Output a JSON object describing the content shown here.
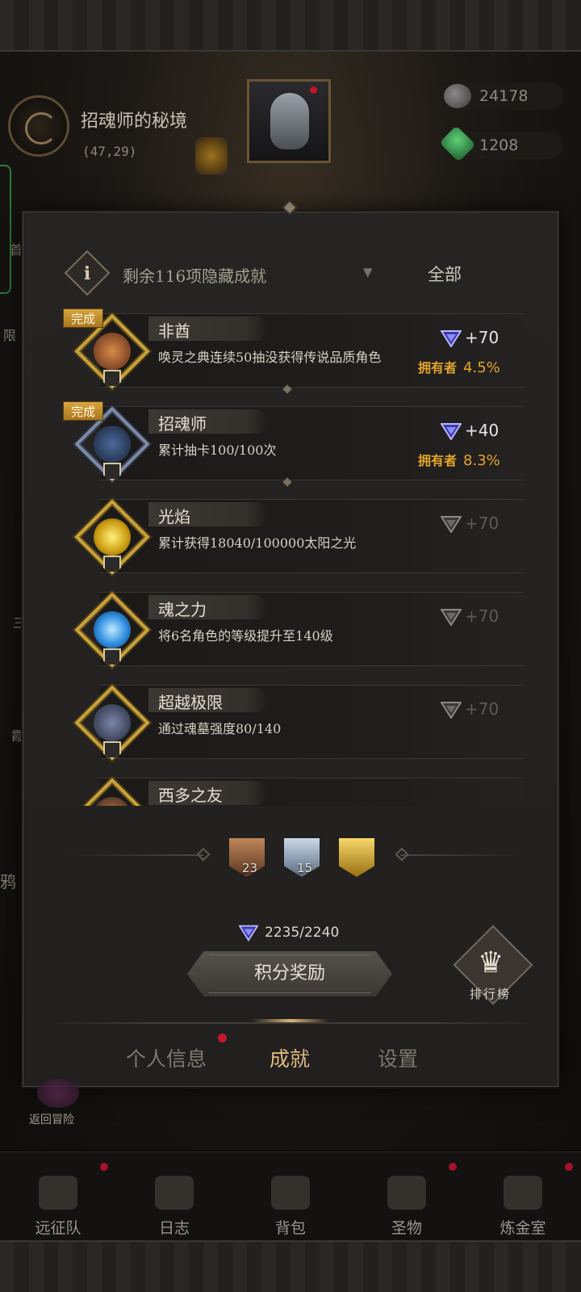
{
  "location": {
    "name": "招魂师的秘境",
    "coords": "(47,29)"
  },
  "resources": [
    {
      "icon": "stone-icon",
      "value": "24178"
    },
    {
      "icon": "emerald-icon",
      "value": "1208"
    }
  ],
  "side_texts": {
    "left_a": "首",
    "left_b": "限",
    "left_c": "三",
    "left_d": "霞",
    "left_e": "鸦"
  },
  "filter": {
    "text": "剩余116项隐藏成就",
    "all_label": "全部"
  },
  "achievements": [
    {
      "done_label": "完成",
      "title": "非酋",
      "desc": "唤灵之典连续50抽没获得传说品质角色",
      "points": "+70",
      "owner_label": "拥有者",
      "owner_pct": "4.5%",
      "completed": true,
      "art_color": "#a0522d"
    },
    {
      "done_label": "完成",
      "title": "招魂师",
      "desc": "累计抽卡100/100次",
      "points": "+40",
      "owner_label": "拥有者",
      "owner_pct": "8.3%",
      "completed": true,
      "art_color": "#2a3a5a"
    },
    {
      "title": "光焰",
      "desc": "累计获得18040/100000太阳之光",
      "points": "+70",
      "completed": false,
      "art_color": "#e3c21a"
    },
    {
      "title": "魂之力",
      "desc": "将6名角色的等级提升至140级",
      "points": "+70",
      "completed": false,
      "art_color": "#4fb3ff"
    },
    {
      "title": "超越极限",
      "desc": "通过魂墓强度80/140",
      "points": "+70",
      "completed": false,
      "art_color": "#3d4660"
    },
    {
      "title": "西多之友",
      "desc": "",
      "points": "",
      "completed": false,
      "art_color": "#7a4a30"
    }
  ],
  "ranks": [
    {
      "icon": "bronze-rank-icon",
      "count": "23",
      "color": "#9a6a45"
    },
    {
      "icon": "silver-rank-icon",
      "count": "15",
      "color": "#8ea2b8"
    },
    {
      "icon": "gold-rank-icon",
      "count": "",
      "color": "#d4a52c"
    }
  ],
  "score": {
    "text": "2235/2240"
  },
  "reward_button": "积分奖励",
  "leaderboard_label": "排行榜",
  "tabs": [
    {
      "label": "个人信息",
      "active": false,
      "dot": true
    },
    {
      "label": "成就",
      "active": true,
      "dot": false
    },
    {
      "label": "设置",
      "active": false,
      "dot": false
    }
  ],
  "return_label": "返回冒险",
  "bottom_nav": [
    {
      "label": "远征队",
      "icon": "helmet-icon",
      "dot": true
    },
    {
      "label": "日志",
      "icon": "scroll-icon",
      "dot": false
    },
    {
      "label": "背包",
      "icon": "backpack-icon",
      "dot": false
    },
    {
      "label": "圣物",
      "icon": "relic-icon",
      "dot": true
    },
    {
      "label": "炼金室",
      "icon": "alchemy-icon",
      "dot": true
    }
  ],
  "colors": {
    "accent_gold": "#e3a42b",
    "tab_active": "#e1b980",
    "notify_red": "#c8162a"
  }
}
